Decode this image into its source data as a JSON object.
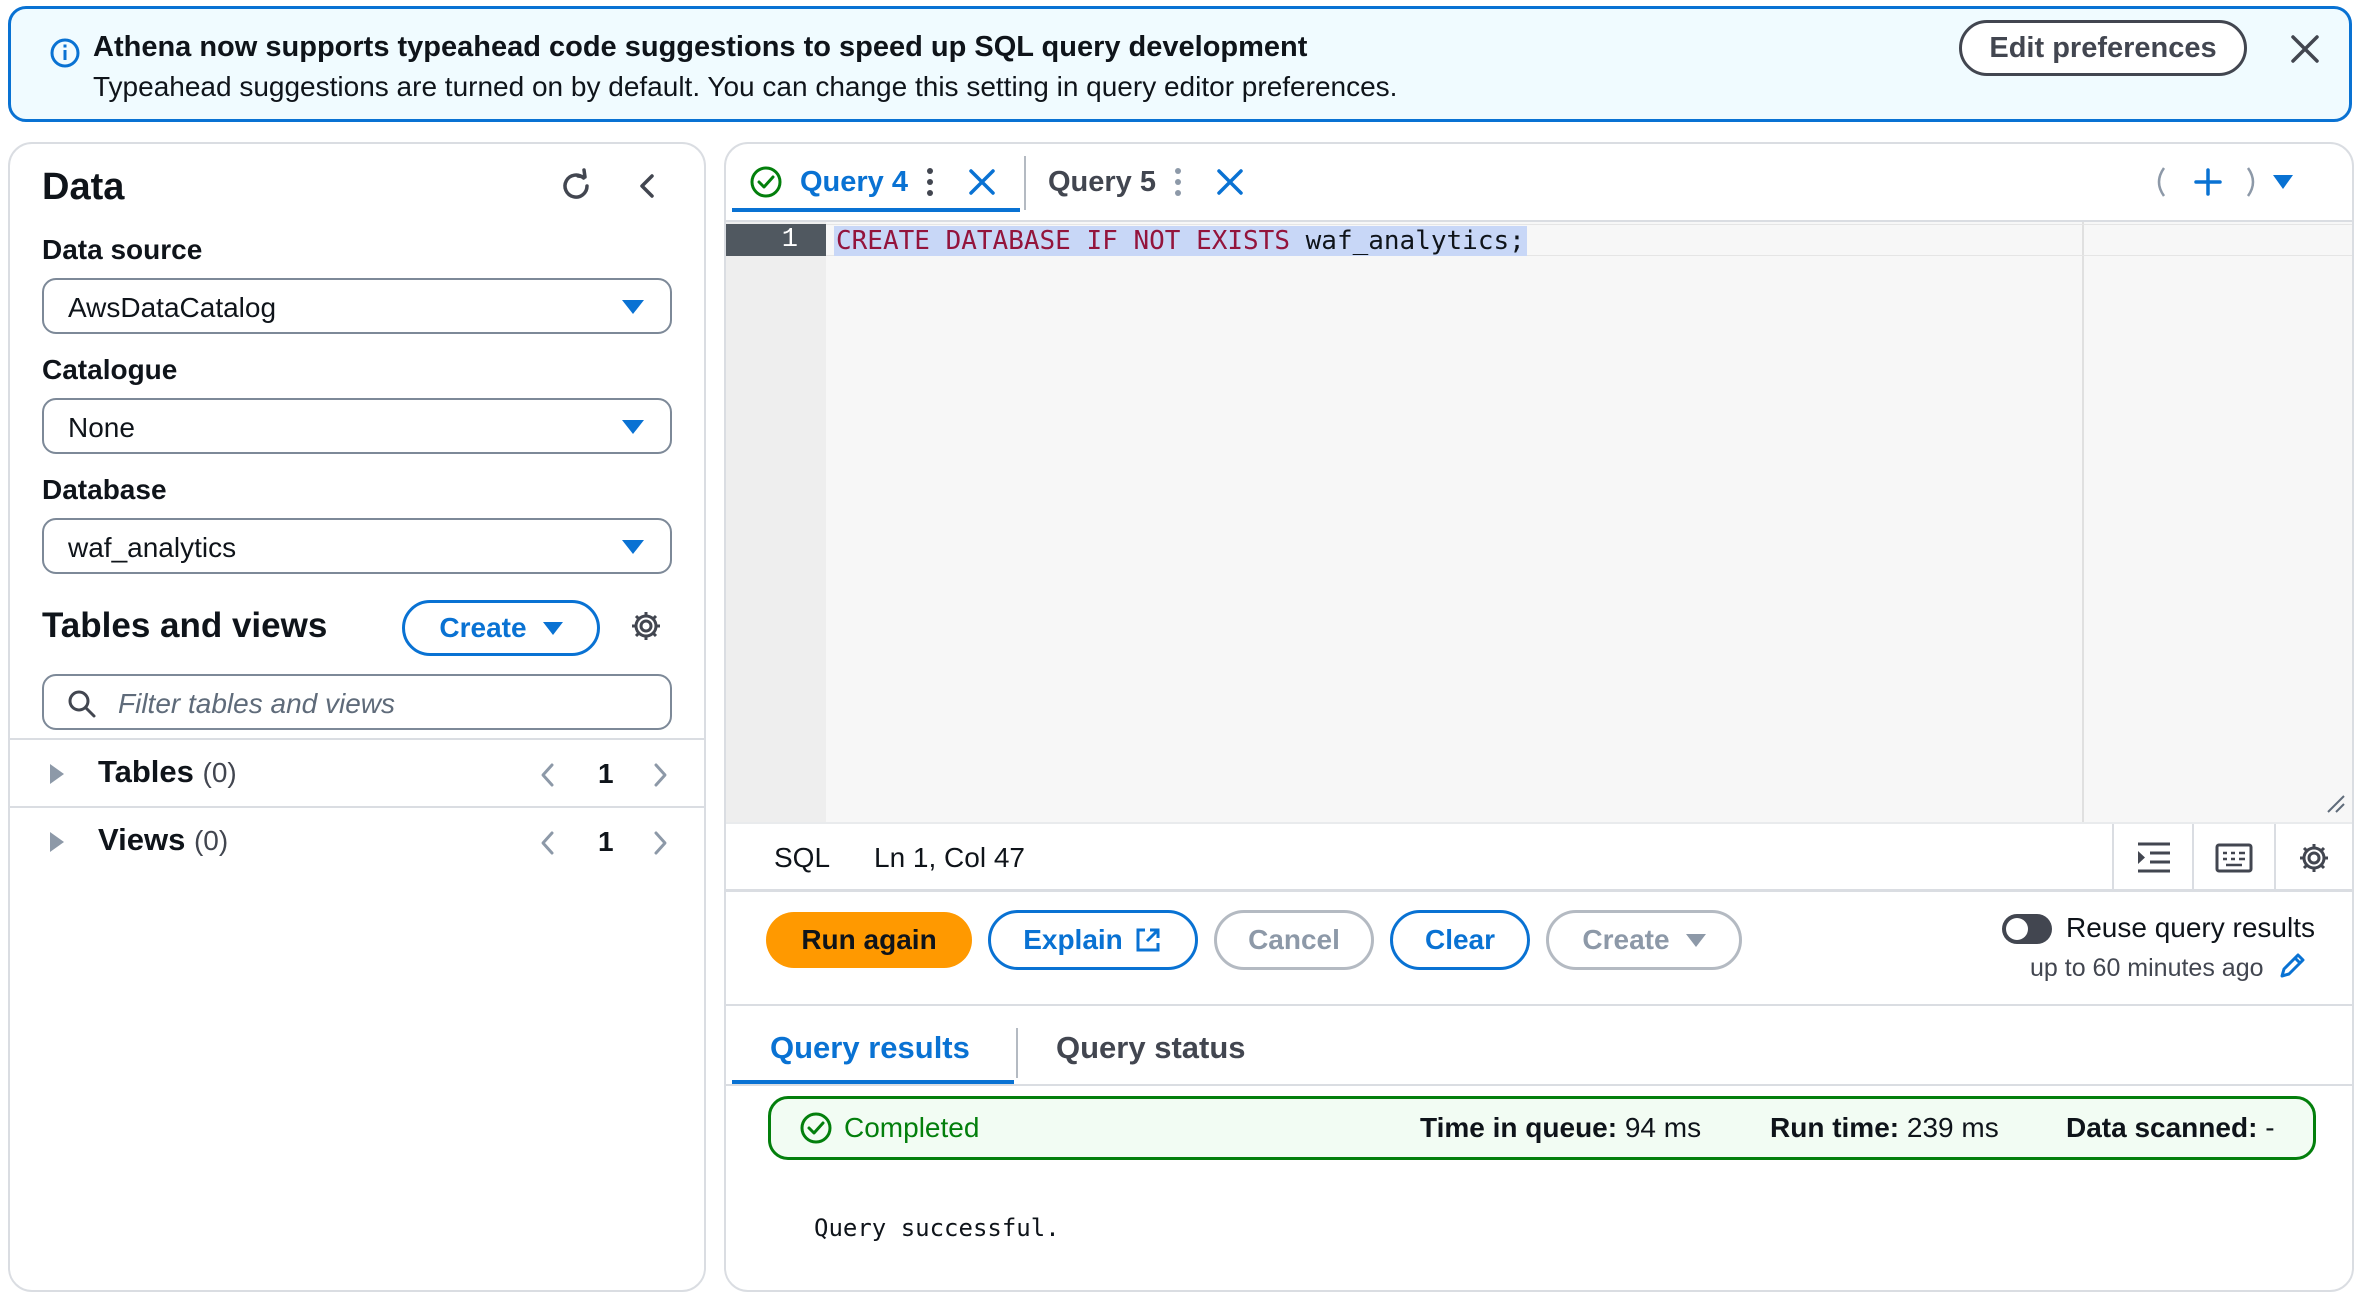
{
  "banner": {
    "title": "Athena now supports typeahead code suggestions to speed up SQL query development",
    "description": "Typeahead suggestions are turned on by default. You can change this setting in query editor preferences.",
    "edit_button": "Edit preferences",
    "icons": {
      "info": "info-icon",
      "close": "close-icon"
    }
  },
  "data_panel": {
    "title": "Data",
    "data_source": {
      "label": "Data source",
      "value": "AwsDataCatalog"
    },
    "catalogue": {
      "label": "Catalogue",
      "value": "None"
    },
    "database": {
      "label": "Database",
      "value": "waf_analytics"
    },
    "tables_views": {
      "title": "Tables and views",
      "create_button": "Create",
      "filter_placeholder": "Filter tables and views"
    },
    "tree": [
      {
        "label": "Tables",
        "count": "(0)",
        "page": "1"
      },
      {
        "label": "Views",
        "count": "(0)",
        "page": "1"
      }
    ]
  },
  "editor": {
    "tabs": [
      {
        "label": "Query 4",
        "active": true,
        "status": "success"
      },
      {
        "label": "Query 5",
        "active": false
      }
    ],
    "line_number": "1",
    "code": {
      "k1": "CREATE",
      "k2": "DATABASE",
      "k3": "IF",
      "k4": "NOT",
      "k5": "EXISTS",
      "ident": "waf_analytics;"
    },
    "status_bar": {
      "language": "SQL",
      "cursor": "Ln 1, Col 47"
    }
  },
  "actions": {
    "run_again": "Run again",
    "explain": "Explain",
    "cancel": "Cancel",
    "clear": "Clear",
    "create": "Create",
    "reuse_label": "Reuse query results",
    "reuse_sub": "up to 60 minutes ago",
    "reuse_enabled": false
  },
  "results": {
    "tabs": [
      "Query results",
      "Query status"
    ],
    "status": "Completed",
    "time_in_queue_label": "Time in queue:",
    "time_in_queue": "94 ms",
    "run_time_label": "Run time:",
    "run_time": "239 ms",
    "data_scanned_label": "Data scanned:",
    "data_scanned": "-",
    "message": "Query successful."
  },
  "colors": {
    "accent": "#0972d3",
    "run_button": "#ff9900",
    "success": "#037f0c",
    "banner_bg": "#f0fbff"
  }
}
